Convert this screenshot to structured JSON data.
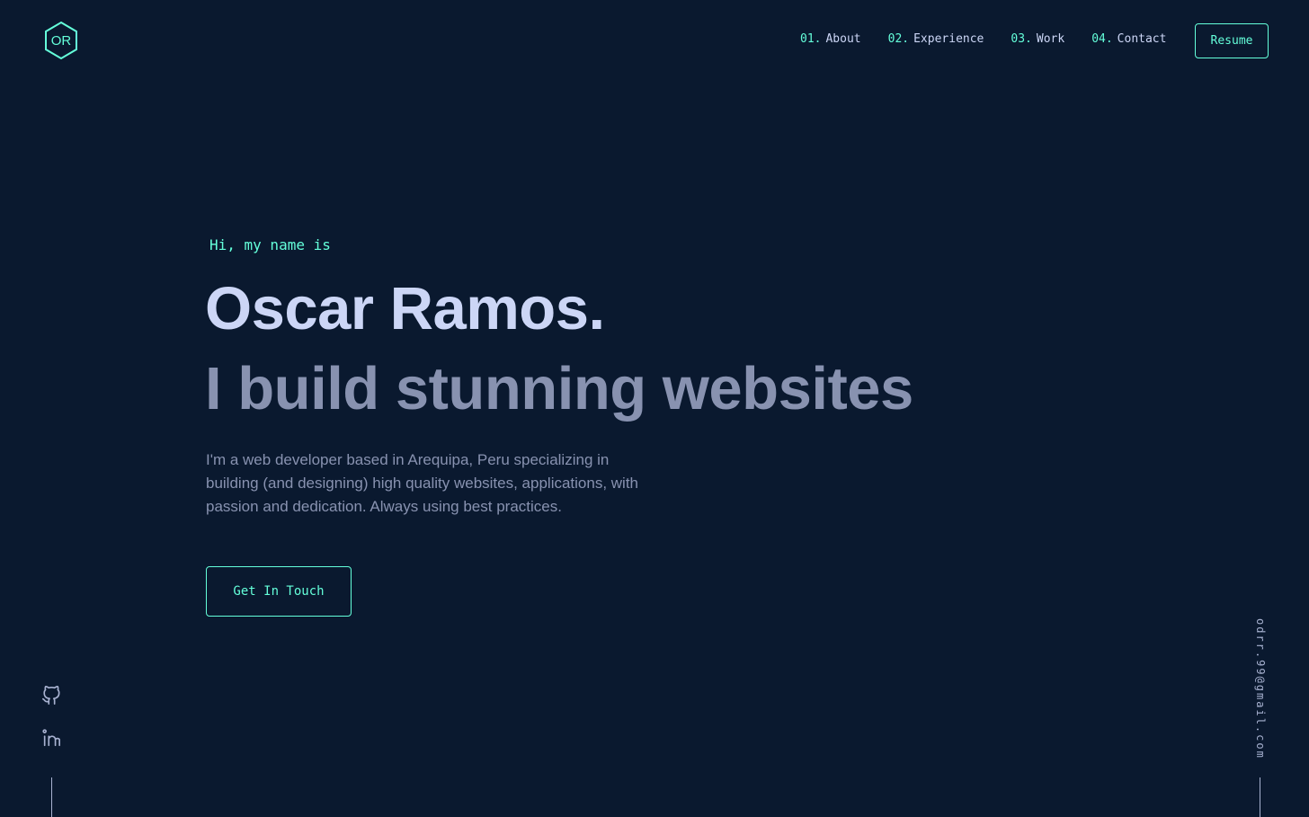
{
  "header": {
    "logo_text": "OR",
    "nav": [
      {
        "num": "01.",
        "label": "About"
      },
      {
        "num": "02.",
        "label": "Experience"
      },
      {
        "num": "03.",
        "label": "Work"
      },
      {
        "num": "04.",
        "label": "Contact"
      }
    ],
    "resume_label": "Resume"
  },
  "hero": {
    "greeting": "Hi, my name is",
    "name": "Oscar Ramos.",
    "tagline": "I build stunning websites",
    "description": "I'm a web developer based in Arequipa, Peru specializing in building (and designing) high quality websites, applications, with passion and dedication. Always using best practices.",
    "cta_label": "Get In Touch"
  },
  "social": [
    {
      "icon": "github-icon"
    },
    {
      "icon": "linkedin-icon"
    }
  ],
  "email": "odrr.99@gmail.com",
  "colors": {
    "background": "#0a192f",
    "accent": "#64ffda",
    "heading": "#ccd6f6",
    "body": "#8892b0",
    "rail": "#a8b2d1"
  }
}
